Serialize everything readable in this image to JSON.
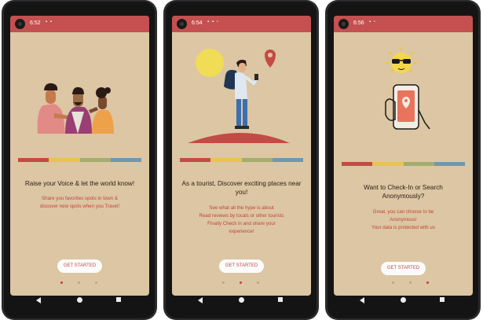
{
  "palette": {
    "status_red": "#c45050",
    "bar_red": "#c44a45",
    "bar_yellow": "#e8c34f",
    "bar_green": "#a3ad6e",
    "bar_blue": "#6d98b0",
    "accent_red": "#c4433f",
    "sun_yellow": "#f0dd55"
  },
  "screens": [
    {
      "time": "6:52",
      "status_icons": [
        "sim-icon",
        "notification-icon"
      ],
      "illustration": "friends-chatting-illustration",
      "title": "Raise your Voice & let the world know!",
      "description": [
        "Share you favorites spots in town &",
        "discover new spots when you Travel!"
      ],
      "button_label": "GET STARTED",
      "page_indicator": {
        "count": 3,
        "active": 1
      }
    },
    {
      "time": "6:54",
      "status_icons": [
        "sim-icon",
        "notification-icon",
        "card-icon"
      ],
      "illustration": "tourist-on-hill-illustration",
      "title": "As a tourist, Discover exciting places near you!",
      "description": [
        "See what all the hype is about",
        "Read reviews by locals or other tourists",
        "Finally Check in and share your",
        "experience!"
      ],
      "button_label": "GET STARTED",
      "page_indicator": {
        "count": 3,
        "active": 2
      }
    },
    {
      "time": "6:56",
      "status_icons": [
        "sim-icon",
        "card-icon"
      ],
      "illustration": "phone-with-cool-sun-illustration",
      "title": "Want to Check-In or Search Anonymously?",
      "description": [
        "Great, you can choose to be",
        "Anonymous!",
        "Your data is protected with us"
      ],
      "button_label": "GET STARTED",
      "page_indicator": {
        "count": 3,
        "active": 3
      }
    }
  ]
}
